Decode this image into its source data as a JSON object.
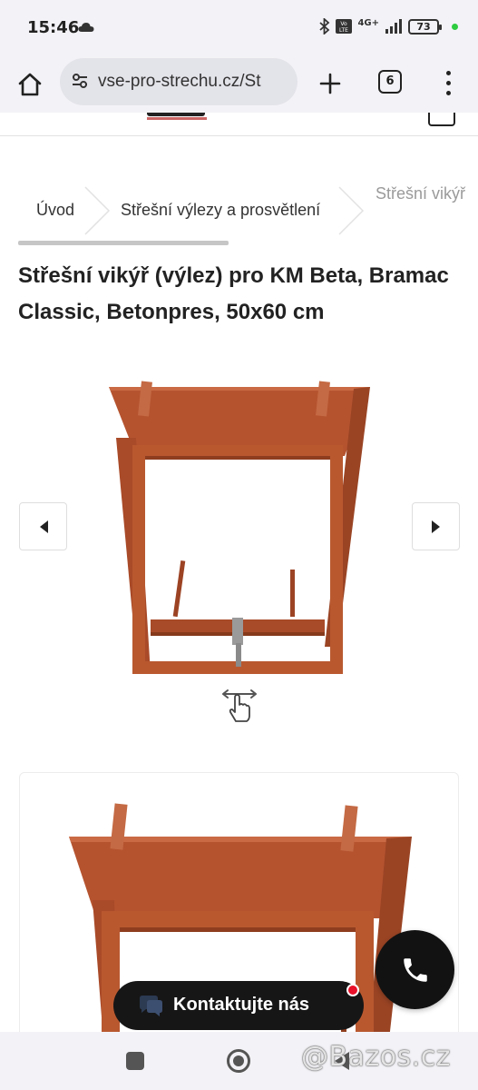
{
  "status_bar": {
    "time": "15:46",
    "network": "4G+",
    "battery": "73"
  },
  "browser": {
    "url": "vse-pro-strechu.cz/St",
    "tab_count": "6"
  },
  "breadcrumb": {
    "items": [
      "Úvod",
      "Střešní výlezy a prosvětlení",
      "Střešní vikýř"
    ]
  },
  "product": {
    "title": "Střešní vikýř (výlez) pro KM Beta, Bramac Classic, Betonpres, 50x60 cm"
  },
  "contact": {
    "label": "Kontaktujte nás"
  },
  "watermark": {
    "text": "@Bazos.cz"
  },
  "colors": {
    "product_rust": "#b5532f",
    "contact_bg": "#161616",
    "notify_red": "#e8102a",
    "status_green": "#2ecc40"
  },
  "icons": [
    "cloud-icon",
    "bluetooth-icon",
    "volte-icon",
    "signal-icon",
    "battery-icon",
    "home-icon",
    "site-settings-icon",
    "plus-icon",
    "tabs-icon",
    "more-icon",
    "chevron-right-icon",
    "arrow-left-icon",
    "arrow-right-icon",
    "swipe-hand-icon",
    "chat-icon",
    "phone-icon"
  ]
}
